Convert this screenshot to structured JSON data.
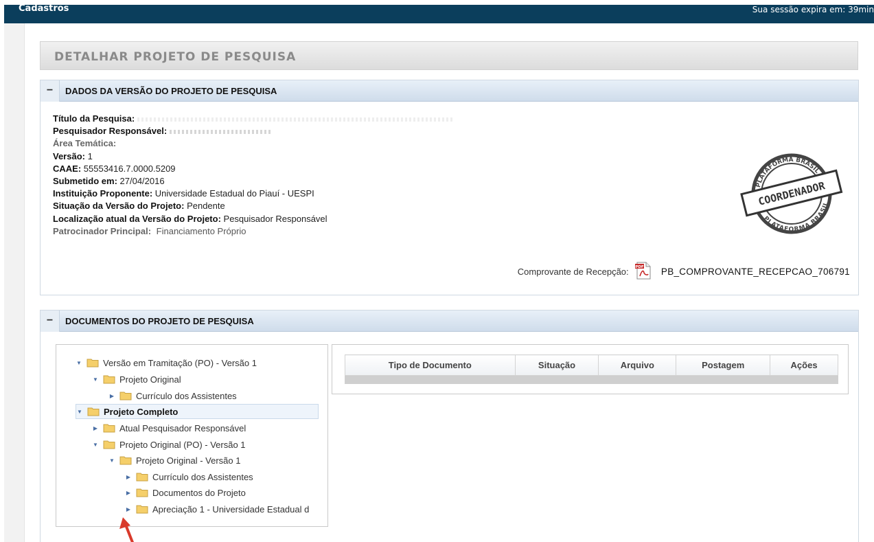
{
  "topbar": {
    "brand": "Cadastros",
    "session": "Sua sessão expira em: 39min"
  },
  "page": {
    "title": "DETALHAR PROJETO DE PESQUISA"
  },
  "panel1": {
    "toggle": "−",
    "title": "DADOS DA VERSÃO DO PROJETO DE PESQUISA",
    "fields": {
      "titulo_label": "Título da Pesquisa:",
      "pesquisador_label": "Pesquisador Responsável:",
      "area_label": "Área Temática:",
      "versao_label": "Versão:",
      "versao_value": " 1",
      "caae_label": "CAAE:",
      "caae_value": " 55553416.7.0000.5209",
      "submetido_label": "Submetido em:",
      "submetido_value": " 27/04/2016",
      "instituicao_label": "Instituição Proponente:",
      "instituicao_value": " Universidade Estadual do Piauí - UESPI",
      "situacao_label": "Situação da Versão do Projeto:",
      "situacao_value": " Pendente",
      "localizacao_label": "Localização atual da Versão do Projeto:",
      "localizacao_value": " Pesquisador Responsável",
      "patrocinador_label": "Patrocinador Principal:",
      "patrocinador_value": " Financiamento Próprio"
    },
    "stamp": {
      "top": "PLATAFORMA BRASIL",
      "center": "COORDENADOR",
      "bottom": "PLATAFORMA BRASIL"
    },
    "comprovante": {
      "label": "Comprovante de Recepção:",
      "file": "PB_COMPROVANTE_RECEPCAO_706791"
    }
  },
  "panel2": {
    "toggle": "−",
    "title": "DOCUMENTOS DO PROJETO DE PESQUISA",
    "tree": [
      {
        "label": "Versão em Tramitação (PO) - Versão 1",
        "expanded": true
      },
      {
        "label": "Projeto Original",
        "expanded": true
      },
      {
        "label": "Currículo dos Assistentes",
        "expanded": false
      },
      {
        "label": "Projeto Completo",
        "expanded": true,
        "selected": true
      },
      {
        "label": "Atual Pesquisador Responsável",
        "expanded": false
      },
      {
        "label": "Projeto Original (PO) - Versão 1",
        "expanded": true
      },
      {
        "label": "Projeto Original - Versão 1",
        "expanded": true
      },
      {
        "label": "Currículo dos Assistentes",
        "expanded": false
      },
      {
        "label": "Documentos do Projeto",
        "expanded": false
      },
      {
        "label": "Apreciação 1 - Universidade Estadual d",
        "expanded": false
      }
    ],
    "table": {
      "columns": [
        "Tipo de Documento",
        "Situação",
        "Arquivo",
        "Postagem",
        "Ações"
      ]
    }
  },
  "colors": {
    "topbar": "#0b3e5c",
    "panel_header": "#cfdceb",
    "annotation_arrow": "#d93a2b"
  }
}
